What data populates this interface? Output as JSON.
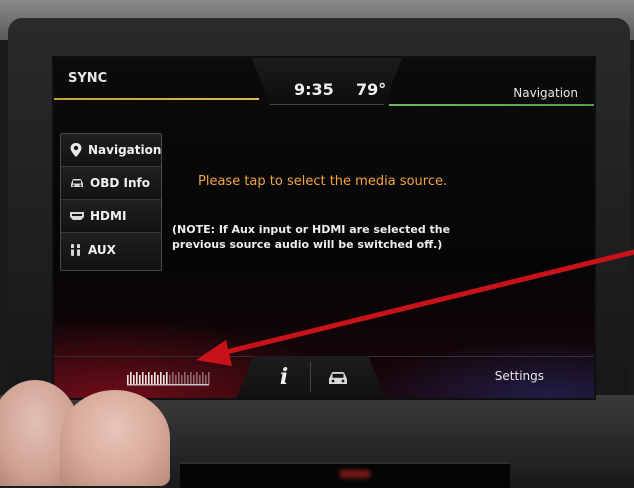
{
  "header": {
    "title": "SYNC",
    "time": "9:35",
    "temperature": "79°",
    "nav_label": "Navigation"
  },
  "side_menu": {
    "items": [
      {
        "label": "Navigation",
        "icon": "map-pin-icon"
      },
      {
        "label": "OBD Info",
        "icon": "car-icon"
      },
      {
        "label": "HDMI",
        "icon": "hdmi-icon"
      },
      {
        "label": "AUX",
        "icon": "audio-plug-icon"
      }
    ]
  },
  "main": {
    "prompt": "Please tap to select the media source.",
    "note_line1": "(NOTE: If Aux input or HDMI are selected the",
    "note_line2": "previous source audio will be switched off.)"
  },
  "bottom_bar": {
    "info_icon": "info-icon",
    "car_icon": "car-icon",
    "settings_label": "Settings",
    "volume_level": 0.5
  },
  "colors": {
    "prompt": "#f3a43b",
    "accent_left": "#e1b94b",
    "accent_right": "#4da050",
    "annotation_arrow": "#c8121a"
  }
}
